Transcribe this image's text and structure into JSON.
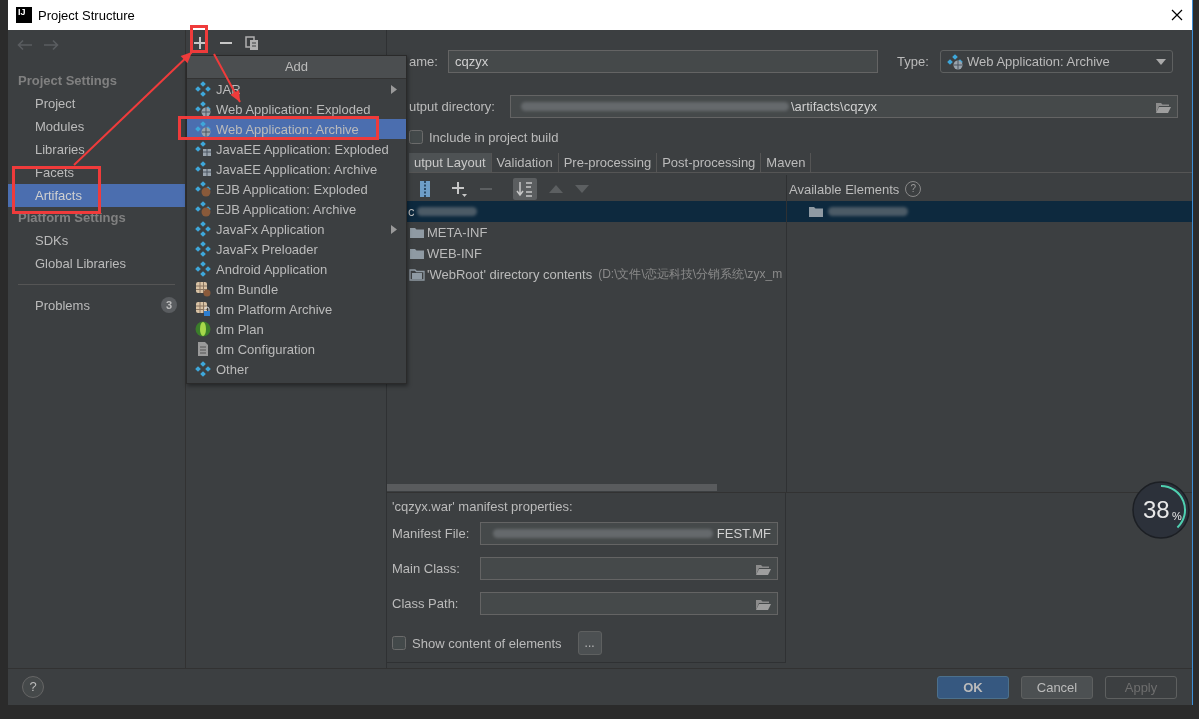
{
  "window": {
    "logo": "IJ",
    "title": "Project Structure"
  },
  "sidebar": {
    "sections": [
      {
        "header": "Project Settings",
        "items": [
          {
            "label": "Project",
            "selected": false
          },
          {
            "label": "Modules",
            "selected": false
          },
          {
            "label": "Libraries",
            "selected": false
          },
          {
            "label": "Facets",
            "selected": false
          },
          {
            "label": "Artifacts",
            "selected": true
          }
        ]
      },
      {
        "header": "Platform Settings",
        "items": [
          {
            "label": "SDKs",
            "selected": false
          },
          {
            "label": "Global Libraries",
            "selected": false
          }
        ]
      }
    ],
    "problems": {
      "label": "Problems",
      "count": "3"
    }
  },
  "add_menu": {
    "title": "Add",
    "items": [
      {
        "label": "JAR",
        "kind": "diamond",
        "submenu": true,
        "selected": false
      },
      {
        "label": "Web Application: Exploded",
        "kind": "web",
        "submenu": false,
        "selected": false
      },
      {
        "label": "Web Application: Archive",
        "kind": "web",
        "submenu": false,
        "selected": true
      },
      {
        "label": "JavaEE Application: Exploded",
        "kind": "javaee",
        "submenu": false,
        "selected": false
      },
      {
        "label": "JavaEE Application: Archive",
        "kind": "javaee",
        "submenu": false,
        "selected": false
      },
      {
        "label": "EJB Application: Exploded",
        "kind": "ejb",
        "submenu": false,
        "selected": false
      },
      {
        "label": "EJB Application: Archive",
        "kind": "ejb",
        "submenu": false,
        "selected": false
      },
      {
        "label": "JavaFx Application",
        "kind": "diamond",
        "submenu": true,
        "selected": false
      },
      {
        "label": "JavaFx Preloader",
        "kind": "diamond",
        "submenu": false,
        "selected": false
      },
      {
        "label": "Android Application",
        "kind": "diamond",
        "submenu": false,
        "selected": false
      },
      {
        "label": "dm Bundle",
        "kind": "bundle",
        "submenu": false,
        "selected": false
      },
      {
        "label": "dm Platform Archive",
        "kind": "bundle-lock",
        "submenu": false,
        "selected": false
      },
      {
        "label": "dm Plan",
        "kind": "plan",
        "submenu": false,
        "selected": false
      },
      {
        "label": "dm Configuration",
        "kind": "config",
        "submenu": false,
        "selected": false
      },
      {
        "label": "Other",
        "kind": "diamond",
        "submenu": false,
        "selected": false
      }
    ]
  },
  "editor": {
    "name": {
      "label": "ame:",
      "value": "cqzyx"
    },
    "type": {
      "label": "Type:",
      "value": "Web Application: Archive"
    },
    "output_directory": {
      "label": "utput directory:",
      "value": "\\artifacts\\cqzyx"
    },
    "include_in_build": {
      "label": "Include in project build",
      "checked": false
    },
    "tabs": [
      {
        "label": "utput Layout",
        "selected": true
      },
      {
        "label": "Validation",
        "selected": false
      },
      {
        "label": "Pre-processing",
        "selected": false
      },
      {
        "label": "Post-processing",
        "selected": false
      },
      {
        "label": "Maven",
        "selected": false
      }
    ],
    "available_elements": {
      "label": "Available Elements",
      "help": "?"
    },
    "tree": [
      {
        "label": "c",
        "kind": "root",
        "selected": true
      },
      {
        "label": "META-INF",
        "kind": "folder",
        "selected": false
      },
      {
        "label": "WEB-INF",
        "kind": "folder",
        "selected": false
      },
      {
        "label": "'WebRoot' directory contents",
        "path": "(D:\\文件\\恋远科技\\分销系统\\zyx_m",
        "kind": "source",
        "selected": false
      }
    ],
    "manifest": {
      "title": "'cqzyx.war' manifest properties:",
      "fields": [
        {
          "label": "Manifest File:",
          "value": "FEST.MF",
          "kind": "text"
        },
        {
          "label": "Main Class:",
          "kind": "browse"
        },
        {
          "label": "Class Path:",
          "kind": "browse"
        }
      ],
      "show_content": {
        "label": "Show content of elements",
        "checked": false
      },
      "more_button": "..."
    }
  },
  "footer": {
    "help": "?",
    "buttons": [
      {
        "label": "OK",
        "kind": "default",
        "disabled": false
      },
      {
        "label": "Cancel",
        "kind": "normal",
        "disabled": false
      },
      {
        "label": "Apply",
        "kind": "normal",
        "disabled": true
      }
    ]
  },
  "usage_gauge": {
    "value": "38",
    "unit": "%",
    "level": 0.38
  }
}
